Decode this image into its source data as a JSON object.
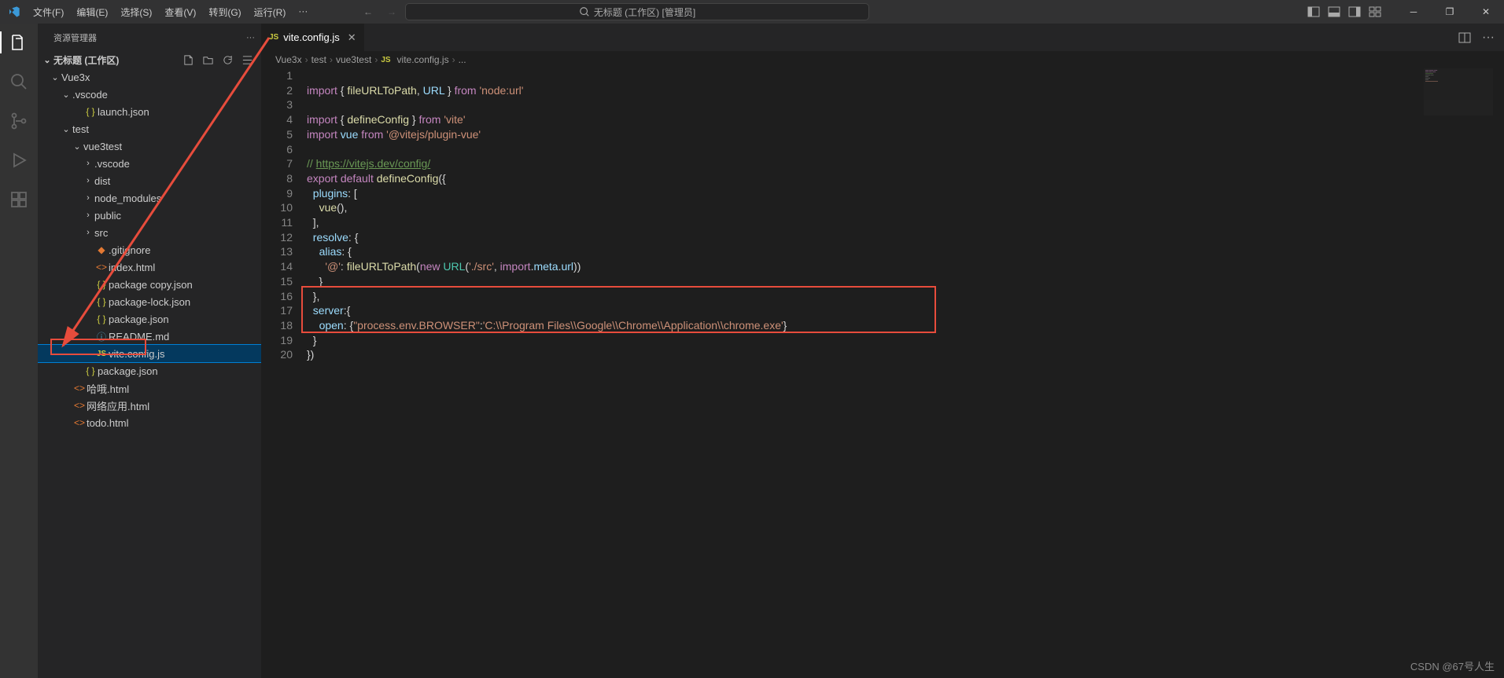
{
  "title": "无标题 (工作区) [管理员]",
  "search_label": "无标题 (工作区) [管理员]",
  "menus": [
    "文件(F)",
    "编辑(E)",
    "选择(S)",
    "查看(V)",
    "转到(G)",
    "运行(R)",
    "···"
  ],
  "sidebar": {
    "title": "资源管理器",
    "workspace": "无标题 (工作区)",
    "tree": [
      {
        "d": 1,
        "t": "folder",
        "open": true,
        "lbl": "Vue3x"
      },
      {
        "d": 2,
        "t": "folder",
        "open": true,
        "lbl": ".vscode"
      },
      {
        "d": 3,
        "t": "json",
        "lbl": "launch.json"
      },
      {
        "d": 2,
        "t": "folder",
        "open": true,
        "lbl": "test"
      },
      {
        "d": 3,
        "t": "folder",
        "open": true,
        "lbl": "vue3test"
      },
      {
        "d": 4,
        "t": "folder",
        "open": false,
        "lbl": ".vscode"
      },
      {
        "d": 4,
        "t": "folder",
        "open": false,
        "lbl": "dist"
      },
      {
        "d": 4,
        "t": "folder",
        "open": false,
        "lbl": "node_modules"
      },
      {
        "d": 4,
        "t": "folder",
        "open": false,
        "lbl": "public"
      },
      {
        "d": 4,
        "t": "folder",
        "open": false,
        "lbl": "src"
      },
      {
        "d": 4,
        "t": "git",
        "lbl": ".gitignore"
      },
      {
        "d": 4,
        "t": "html",
        "lbl": "index.html"
      },
      {
        "d": 4,
        "t": "json",
        "lbl": "package copy.json"
      },
      {
        "d": 4,
        "t": "json",
        "lbl": "package-lock.json"
      },
      {
        "d": 4,
        "t": "json",
        "lbl": "package.json"
      },
      {
        "d": 4,
        "t": "readme",
        "lbl": "README.md"
      },
      {
        "d": 4,
        "t": "js",
        "lbl": "vite.config.js",
        "sel": true
      },
      {
        "d": 3,
        "t": "json",
        "lbl": "package.json"
      },
      {
        "d": 2,
        "t": "html",
        "lbl": "哈哦.html"
      },
      {
        "d": 2,
        "t": "html",
        "lbl": "网络应用.html"
      },
      {
        "d": 2,
        "t": "html",
        "lbl": "todo.html"
      }
    ]
  },
  "tab": {
    "label": "vite.config.js"
  },
  "breadcrumbs": [
    "Vue3x",
    "test",
    "vue3test",
    "vite.config.js",
    "..."
  ],
  "code": {
    "lines": 20,
    "l1_a": "import",
    "l1_b": "{ ",
    "l1_c": "fileURLToPath",
    "l1_d": ", ",
    "l1_e": "URL",
    "l1_f": " }",
    "l1_g": " from ",
    "l1_h": "'node:url'",
    "l3_a": "import",
    "l3_b": " { ",
    "l3_c": "defineConfig",
    "l3_d": " } ",
    "l3_e": "from ",
    "l3_f": "'vite'",
    "l4_a": "import",
    "l4_b": " ",
    "l4_c": "vue",
    "l4_d": " ",
    "l4_e": "from ",
    "l4_f": "'@vitejs/plugin-vue'",
    "l6": "// ",
    "l6_url": "https://vitejs.dev/config/",
    "l7_a": "export",
    "l7_b": " ",
    "l7_c": "default",
    "l7_d": " ",
    "l7_e": "defineConfig",
    "l7_f": "({",
    "l8_a": "  ",
    "l8_b": "plugins",
    "l8_c": ": [",
    "l9_a": "    ",
    "l9_b": "vue",
    "l9_c": "(),",
    "l10": "  ],",
    "l11_a": "  ",
    "l11_b": "resolve",
    "l11_c": ": {",
    "l12_a": "    ",
    "l12_b": "alias",
    "l12_c": ": {",
    "l13_a": "      ",
    "l13_b": "'@'",
    "l13_c": ": ",
    "l13_d": "fileURLToPath",
    "l13_e": "(",
    "l13_f": "new",
    "l13_g": " ",
    "l13_h": "URL",
    "l13_i": "(",
    "l13_j": "'./src'",
    "l13_k": ", ",
    "l13_l": "import",
    "l13_m": ".",
    "l13_n": "meta",
    "l13_o": ".",
    "l13_p": "url",
    "l13_q": "))",
    "l14": "    }",
    "l15": "  },",
    "l16_a": "  ",
    "l16_b": "server",
    "l16_c": ":{",
    "l17_a": "    ",
    "l17_b": "open",
    "l17_c": ": {",
    "l17_d": "\"process.env.BROWSER\"",
    "l17_e": ":",
    "l17_f": "'C:\\\\Program Files\\\\Google\\\\Chrome\\\\Application\\\\chrome.exe'",
    "l17_g": "}",
    "l18": "  }",
    "l19": "})"
  },
  "watermark": "CSDN @67号人生"
}
